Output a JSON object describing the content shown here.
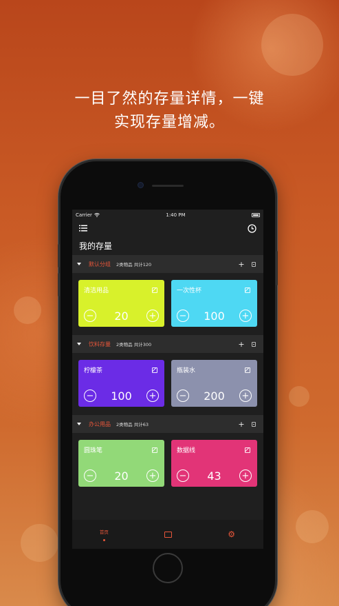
{
  "headline": {
    "line1": "一目了然的存量详情，一键",
    "line2": "实现存量增减。"
  },
  "status_bar": {
    "carrier": "Carrier",
    "time": "1:40 PM"
  },
  "toolbar": {
    "menu_icon": "list-icon",
    "history_icon": "clock-icon"
  },
  "page_title": "我的存量",
  "categories": [
    {
      "name": "默认分组",
      "meta": "2类物品 共计120",
      "items": [
        {
          "name": "清洁用品",
          "qty": "20",
          "color": "#d8f12b"
        },
        {
          "name": "一次性杯",
          "qty": "100",
          "color": "#4ed8f3"
        }
      ]
    },
    {
      "name": "饮料存量",
      "meta": "2类物品 共计300",
      "items": [
        {
          "name": "柠檬茶",
          "qty": "100",
          "color": "#6b2ce6"
        },
        {
          "name": "瓶装水",
          "qty": "200",
          "color": "#8c91ad"
        }
      ]
    },
    {
      "name": "办公用品",
      "meta": "2类物品 共计63",
      "items": [
        {
          "name": "圆珠笔",
          "qty": "20",
          "color": "#92d978"
        },
        {
          "name": "数据线",
          "qty": "43",
          "color": "#e23477"
        }
      ]
    }
  ],
  "controls": {
    "add": "+",
    "minus": "−",
    "plus": "+"
  },
  "tabbar": {
    "home_label": "首页",
    "chart_icon": "chart-icon",
    "settings_icon": "gear-icon"
  },
  "colors": {
    "accent": "#e8563a",
    "background_top": "#b9461b",
    "background_bottom": "#d98a4b",
    "screen": "#1f1f1f",
    "category_bar": "#2d2d2d"
  }
}
